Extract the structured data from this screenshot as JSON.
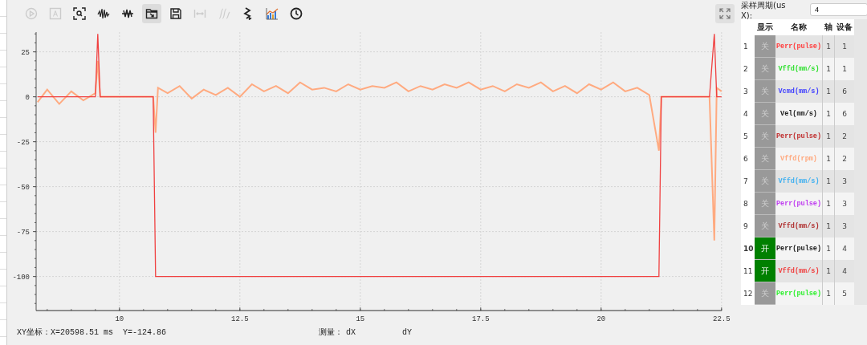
{
  "toolbar": [
    {
      "kind": "play",
      "selected": false,
      "disabled": true
    },
    {
      "kind": "text",
      "selected": false,
      "disabled": true
    },
    {
      "kind": "zoom",
      "selected": false,
      "disabled": false
    },
    {
      "kind": "wave",
      "selected": false,
      "disabled": false
    },
    {
      "kind": "cross",
      "selected": false,
      "disabled": false
    },
    {
      "kind": "folder",
      "selected": true,
      "disabled": false
    },
    {
      "kind": "save",
      "selected": false,
      "disabled": false
    },
    {
      "kind": "measure",
      "selected": false,
      "disabled": true
    },
    {
      "kind": "fx",
      "selected": false,
      "disabled": true
    },
    {
      "kind": "zigzag",
      "selected": false,
      "disabled": false
    },
    {
      "kind": "bars",
      "selected": false,
      "disabled": false
    },
    {
      "kind": "clock",
      "selected": false,
      "disabled": false
    }
  ],
  "chart": {
    "chart_data": {
      "type": "line",
      "grid": true,
      "xlim": [
        8.27,
        22.5
      ],
      "ylim": [
        -119,
        36
      ],
      "xticks": [
        10,
        12.5,
        15,
        17.5,
        20,
        22.5
      ],
      "yticks": [
        25,
        0,
        -25,
        -50,
        -75,
        -100
      ],
      "x": [
        8.3,
        8.5,
        8.75,
        9,
        9.25,
        9.5,
        9.55,
        9.6,
        9.75,
        10,
        10.25,
        10.5,
        10.7,
        10.75,
        10.8,
        11,
        11.25,
        11.5,
        11.75,
        12,
        12.25,
        12.5,
        12.75,
        13,
        13.25,
        13.5,
        13.75,
        14,
        14.25,
        14.5,
        14.75,
        15,
        15.25,
        15.5,
        15.75,
        16,
        16.25,
        16.5,
        16.75,
        17,
        17.25,
        17.5,
        17.75,
        18,
        18.25,
        18.5,
        18.75,
        19,
        19.25,
        19.5,
        19.75,
        20,
        20.25,
        20.5,
        20.75,
        21,
        21.2,
        21.25,
        21.5,
        21.75,
        22,
        22.25,
        22.35,
        22.4,
        22.5
      ],
      "series": [
        {
          "color": "#ffaa80",
          "values": [
            -3,
            4,
            -4,
            3,
            -2,
            2,
            20,
            0,
            0,
            0,
            0,
            0,
            0,
            -20,
            5,
            2,
            6,
            -1,
            4,
            1,
            5,
            0,
            7,
            3,
            6,
            2,
            8,
            4,
            5,
            3,
            7,
            4,
            6,
            5,
            8,
            3,
            6,
            4,
            7,
            5,
            8,
            4,
            6,
            3,
            7,
            5,
            8,
            3,
            6,
            2,
            7,
            4,
            8,
            3,
            5,
            1,
            -30,
            0,
            0,
            0,
            0,
            0,
            -80,
            5,
            3
          ]
        },
        {
          "color": "#f04040",
          "values": [
            0,
            0,
            0,
            0,
            0,
            0,
            35,
            0,
            0,
            0,
            0,
            0,
            0,
            -100,
            -100,
            -100,
            -100,
            -100,
            -100,
            -100,
            -100,
            -100,
            -100,
            -100,
            -100,
            -100,
            -100,
            -100,
            -100,
            -100,
            -100,
            -100,
            -100,
            -100,
            -100,
            -100,
            -100,
            -100,
            -100,
            -100,
            -100,
            -100,
            -100,
            -100,
            -100,
            -100,
            -100,
            -100,
            -100,
            -100,
            -100,
            -100,
            -100,
            -100,
            -100,
            -100,
            -100,
            0,
            0,
            0,
            0,
            0,
            35,
            0,
            0
          ]
        }
      ]
    }
  },
  "status": {
    "coords": "XY坐标：X=20598.51 ms",
    "y": "Y=-124.86",
    "measure": "测量：",
    "dx": "dX",
    "dy": "dY"
  },
  "sample": {
    "label": "采样周期(us X):",
    "value": "4"
  },
  "table": {
    "columns": [
      "显示",
      "名称",
      "轴",
      "设备"
    ],
    "rows": [
      {
        "index": "1",
        "on": false,
        "display": "关",
        "name": "Perr(pulse)",
        "color": "#ff4040",
        "axis": "1",
        "device": "1",
        "selected": false
      },
      {
        "index": "2",
        "on": false,
        "display": "关",
        "name": "Vffd(mm/s)",
        "color": "#30e030",
        "axis": "1",
        "device": "1",
        "selected": false
      },
      {
        "index": "3",
        "on": false,
        "display": "关",
        "name": "Vcmd(mm/s)",
        "color": "#4040ff",
        "axis": "1",
        "device": "6",
        "selected": false
      },
      {
        "index": "4",
        "on": false,
        "display": "关",
        "name": "Vel(mm/s)",
        "color": "#202020",
        "axis": "1",
        "device": "6",
        "selected": false
      },
      {
        "index": "5",
        "on": false,
        "display": "关",
        "name": "Perr(pulse)",
        "color": "#c03030",
        "axis": "1",
        "device": "2",
        "selected": false
      },
      {
        "index": "6",
        "on": false,
        "display": "关",
        "name": "Vffd(rpm)",
        "color": "#ffaa80",
        "axis": "1",
        "device": "2",
        "selected": false
      },
      {
        "index": "7",
        "on": false,
        "display": "关",
        "name": "Vffd(mm/s)",
        "color": "#40b0f0",
        "axis": "1",
        "device": "3",
        "selected": false
      },
      {
        "index": "8",
        "on": false,
        "display": "关",
        "name": "Perr(pulse)",
        "color": "#c040f0",
        "axis": "1",
        "device": "3",
        "selected": false
      },
      {
        "index": "9",
        "on": false,
        "display": "关",
        "name": "Vffd(mm/s)",
        "color": "#b03030",
        "axis": "1",
        "device": "3",
        "selected": false
      },
      {
        "index": "10",
        "on": true,
        "display": "开",
        "name": "Perr(pulse)",
        "color": "#202020",
        "axis": "1",
        "device": "4",
        "selected": true
      },
      {
        "index": "11",
        "on": true,
        "display": "开",
        "name": "Vffd(mm/s)",
        "color": "#f04040",
        "axis": "1",
        "device": "4",
        "selected": false
      },
      {
        "index": "12",
        "on": false,
        "display": "关",
        "name": "Perr(pulse)",
        "color": "#30f030",
        "axis": "1",
        "device": "5",
        "selected": false
      }
    ]
  }
}
